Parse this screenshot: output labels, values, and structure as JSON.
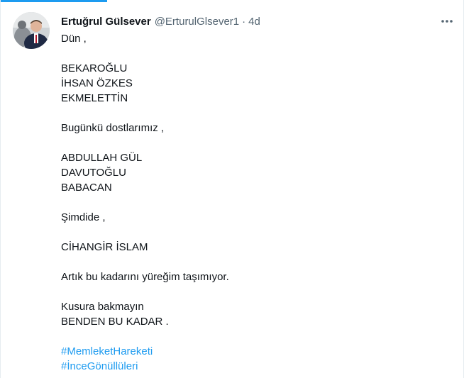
{
  "tweet": {
    "author_name": "Ertuğrul Gülsever",
    "handle": "@ErturulGlsever1",
    "separator": "·",
    "time": "4d",
    "more_icon": "more-horizontal-icon",
    "avatar": "avatar",
    "lines": [
      "Dün ,",
      "",
      "BEKAROĞLU",
      "İHSAN ÖZKES",
      "EKMELETTİN",
      "",
      "Bugünkü dostlarımız ,",
      "",
      "ABDULLAH GÜL",
      "DAVUTOĞLU",
      "BABACAN",
      "",
      "Şimdide ,",
      "",
      "CİHANGİR İSLAM",
      "",
      "Artık bu kadarını yüreğim taşımıyor.",
      "",
      "Kusura bakmayın",
      "BENDEN BU KADAR ."
    ],
    "hashtags": [
      "#MemleketHareketi",
      "#İnceGönüllüleri"
    ]
  },
  "colors": {
    "link": "#1d9bf0",
    "text": "#0f1419",
    "muted": "#536471",
    "accent_bar": "#1d9bf0"
  }
}
